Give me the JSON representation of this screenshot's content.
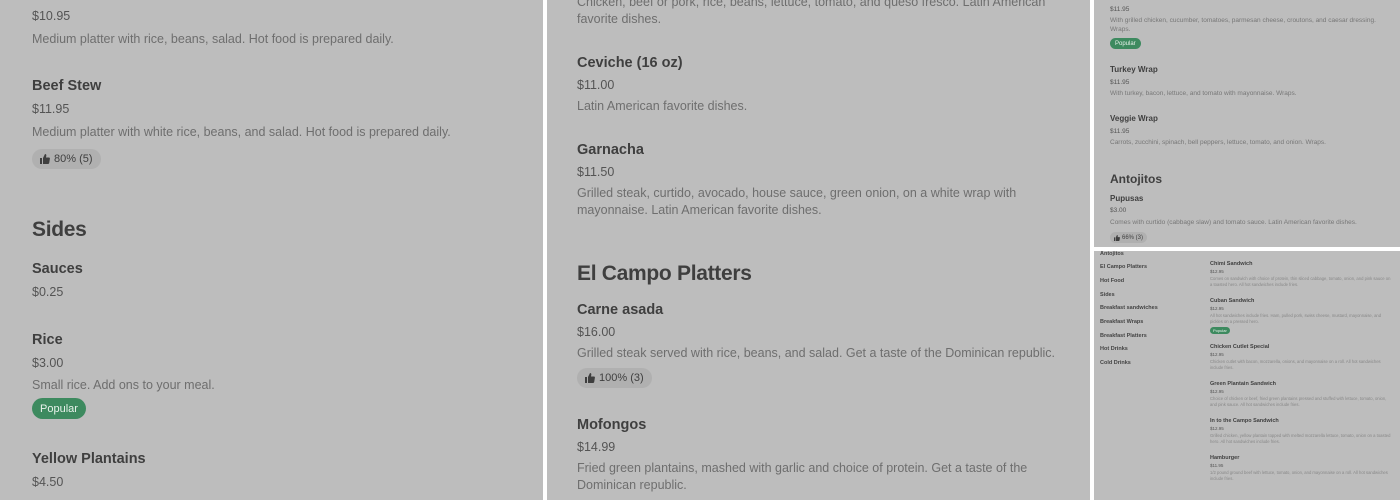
{
  "panel1": {
    "top_price": "$10.95",
    "top_desc": "Medium platter with rice, beans, salad. Hot food is prepared daily.",
    "beef_stew": {
      "name": "Beef Stew",
      "price": "$11.95",
      "desc": "Medium platter with white rice, beans, and salad. Hot food is prepared daily.",
      "rating": "80% (5)"
    },
    "sides_heading": "Sides",
    "sauces": {
      "name": "Sauces",
      "price": "$0.25"
    },
    "rice": {
      "name": "Rice",
      "price": "$3.00",
      "desc": "Small rice. Add ons to your meal.",
      "badge": "Popular"
    },
    "yellow_plantains": {
      "name": "Yellow Plantains",
      "price": "$4.50"
    }
  },
  "panel2": {
    "top_desc": "Chicken, beef or pork, rice, beans, lettuce, tomato, and queso fresco. Latin American favorite dishes.",
    "ceviche": {
      "name": "Ceviche (16 oz)",
      "price": "$11.00",
      "desc": "Latin American favorite dishes."
    },
    "garnacha": {
      "name": "Garnacha",
      "price": "$11.50",
      "desc": "Grilled steak, curtido, avocado, house sauce, green onion, on a white wrap with mayonnaise. Latin American favorite dishes."
    },
    "platters_heading": "El Campo Platters",
    "carne_asada": {
      "name": "Carne asada",
      "price": "$16.00",
      "desc": "Grilled steak served with rice, beans, and salad. Get a taste of the Dominican republic.",
      "rating": "100% (3)"
    },
    "mofongos": {
      "name": "Mofongos",
      "price": "$14.99",
      "desc": "Fried green plantains, mashed with garlic and choice of protein. Get a taste of the Dominican republic."
    }
  },
  "panel3": {
    "top_price": "$11.95",
    "top_desc": "With grilled chicken, cucumber, tomatoes, parmesan cheese, croutons, and caesar dressing. Wraps.",
    "top_badge": "Popular",
    "turkey_wrap": {
      "name": "Turkey Wrap",
      "price": "$11.95",
      "desc": "With turkey, bacon, lettuce, and tomato with mayonnaise. Wraps."
    },
    "veggie_wrap": {
      "name": "Veggie Wrap",
      "price": "$11.95",
      "desc": "Carrots, zucchini, spinach, bell peppers, lettuce, tomato, and onion. Wraps."
    },
    "antojitos_heading": "Antojitos",
    "pupusas": {
      "name": "Pupusas",
      "price": "$3.00",
      "desc": "Comes with curtido (cabbage slaw) and tomato sauce. Latin American favorite dishes.",
      "rating": "66% (3)"
    }
  },
  "panel4": {
    "nav": [
      "Antojitos",
      "El Campo Platters",
      "Hot Food",
      "Sides",
      "Breakfast sandwiches",
      "Breakfast Wraps",
      "Breakfast Platters",
      "Hot Drinks",
      "Cold Drinks"
    ],
    "items": [
      {
        "name": "Chimi Sandwich",
        "price": "$12.95",
        "desc": "Comes on sandwich with choice of protein, thin sliced cabbage, tomato, onion, and pink sauce on a toasted hero. All hot sandwiches include fries."
      },
      {
        "name": "Cuban Sandwich",
        "price": "$12.95",
        "desc": "All hot sandwiches include fries. Ham, pulled pork, swiss cheese, mustard, mayonnaise, and pickles on a pressed hero.",
        "badge": "Popular"
      },
      {
        "name": "Chicken Cutlet Special",
        "price": "$12.95",
        "desc": "Chicken cutlet with bacon, mozzarella, onions, and mayonnaise on a roll. All hot sandwiches include fries."
      },
      {
        "name": "Green Plantain Sandwich",
        "price": "$12.95",
        "desc": "Choice of chicken or beef, fried green plantains pressed and stuffed with lettuce, tomato, onion, and pink sauce. All hot sandwiches include fries."
      },
      {
        "name": "In to the Campo Sandwich",
        "price": "$12.95",
        "desc": "Grilled chicken, yellow plantain topped with melted mozzarella lettuce, tomato, onion on a toasted hero. All hot sandwiches include fries."
      },
      {
        "name": "Hamburger",
        "price": "$11.95",
        "desc": "1/2 pound ground beef with lettuce, tomato, onion, and mayonnaise on a roll. All hot sandwiches include fries."
      }
    ]
  },
  "icons": {
    "thumbs_up": "thumbs-up-icon"
  },
  "colors": {
    "popular_badge": "#3d8a5f",
    "overlay": "#bdbdbd"
  }
}
